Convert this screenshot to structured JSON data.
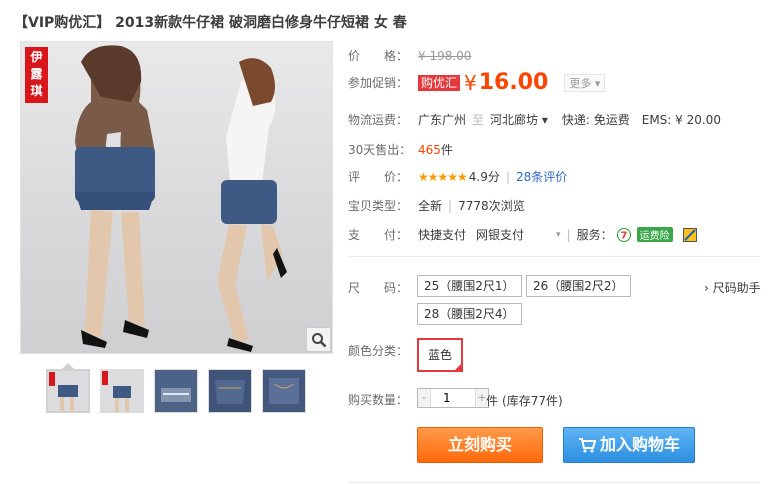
{
  "product": {
    "title": "【VIP购优汇】 2013新款牛仔裙 破洞磨白修身牛仔短裙 女 春",
    "brand_seal": [
      "伊",
      "露",
      "琪"
    ]
  },
  "price": {
    "label": "价　　格：",
    "original": "¥ 198.00"
  },
  "promo": {
    "label": "参加促销：",
    "tag": "购优汇",
    "currency": "¥",
    "amount": "16.00",
    "more_label": "更多 ▾"
  },
  "shipping": {
    "label": "物流运费：",
    "from": "广东广州",
    "sep": "至",
    "to": "河北廊坊 ▾",
    "express": "快递: 免运费",
    "ems": "EMS: ¥ 20.00"
  },
  "sales": {
    "label": "30天售出：",
    "count": "465",
    "unit": "件"
  },
  "rating": {
    "label": "评　　价：",
    "stars": "★★★★★",
    "score": "4.9分",
    "reviews": "28条评价"
  },
  "condition": {
    "label": "宝贝类型：",
    "value": "全新",
    "views": "7778次浏览"
  },
  "payment": {
    "label": "支　　付：",
    "method1": "快捷支付",
    "method2": "网银支付",
    "service_label": "服务："
  },
  "service_badge": "运费险",
  "size": {
    "label": "尺　　码：",
    "options": [
      "25（腰围2尺1）",
      "26（腰围2尺2）",
      "28（腰围2尺4）"
    ],
    "helper": "› 尺码助手"
  },
  "color": {
    "label": "颜色分类：",
    "option": "蓝色"
  },
  "quantity": {
    "label": "购买数量：",
    "minus": "-",
    "value": "1",
    "plus": "+",
    "unit": "件",
    "stock": "(库存77件)"
  },
  "buttons": {
    "buy_now": "立刻购买",
    "add_to_cart": "加入购物车"
  },
  "colors": {
    "accent": "#ff4400",
    "promo_tag": "#e4393c",
    "buy_button": "#ff7a1a",
    "cart_button": "#3a9be8"
  }
}
